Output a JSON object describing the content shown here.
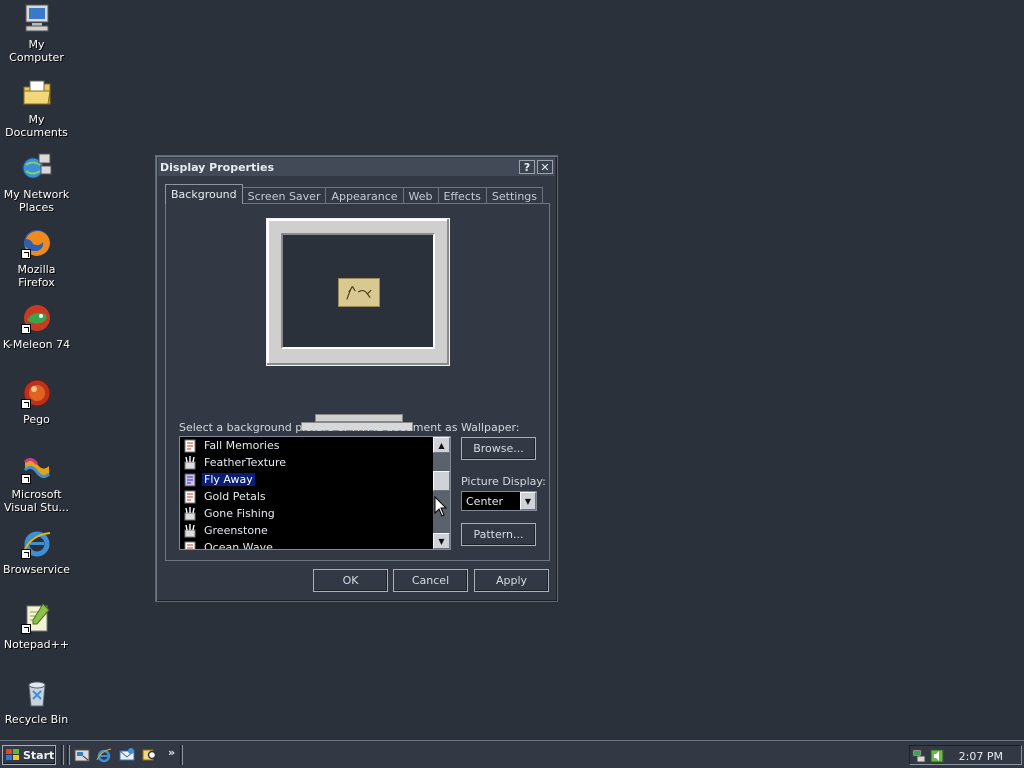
{
  "desktop": {
    "icons": [
      {
        "label": "My Computer",
        "icon": "computer-icon"
      },
      {
        "label": "My Documents",
        "icon": "documents-folder-icon"
      },
      {
        "label": "My Network Places",
        "icon": "network-places-icon"
      },
      {
        "label": "Mozilla Firefox",
        "icon": "firefox-icon"
      },
      {
        "label": "K-Meleon 74",
        "icon": "kmeleon-icon"
      },
      {
        "label": "Pego",
        "icon": "pego-icon"
      },
      {
        "label": "Microsoft Visual Stu...",
        "icon": "visual-studio-icon"
      },
      {
        "label": "Browservice",
        "icon": "internet-explorer-icon"
      },
      {
        "label": "Notepad++",
        "icon": "notepadpp-icon"
      },
      {
        "label": "Recycle Bin",
        "icon": "recycle-bin-icon"
      }
    ]
  },
  "dialog": {
    "title": "Display Properties",
    "help_label": "?",
    "close_label": "✕",
    "tabs": [
      {
        "label": "Background",
        "active": true
      },
      {
        "label": "Screen Saver"
      },
      {
        "label": "Appearance"
      },
      {
        "label": "Web"
      },
      {
        "label": "Effects"
      },
      {
        "label": "Settings"
      }
    ],
    "background": {
      "select_label": "Select a background picture or HTML document as Wallpaper:",
      "wallpaper_items": [
        {
          "name": "Fall Memories",
          "icon": "html-doc-icon"
        },
        {
          "name": "FeatherTexture",
          "icon": "paint-icon"
        },
        {
          "name": "Fly Away",
          "icon": "html-doc-icon",
          "selected": true
        },
        {
          "name": "Gold Petals",
          "icon": "html-doc-icon"
        },
        {
          "name": "Gone Fishing",
          "icon": "paint-icon"
        },
        {
          "name": "Greenstone",
          "icon": "paint-icon"
        },
        {
          "name": "Ocean Wave",
          "icon": "html-doc-icon"
        }
      ],
      "browse_label": "Browse...",
      "picture_display_label": "Picture Display:",
      "picture_display_value": "Center",
      "pattern_label": "Pattern..."
    },
    "ok_label": "OK",
    "cancel_label": "Cancel",
    "apply_label": "Apply"
  },
  "taskbar": {
    "start_label": "Start",
    "quick_launch": [
      "show-desktop-icon",
      "internet-explorer-icon",
      "outlook-express-icon",
      "search-icon"
    ],
    "more_label": "»",
    "tray_icons": [
      "network-icon",
      "volume-icon"
    ],
    "clock": "2:07 PM"
  },
  "colors": {
    "desktop_bg": "#2b313a",
    "window_bg": "#323944",
    "selection": "#0a1e78"
  }
}
